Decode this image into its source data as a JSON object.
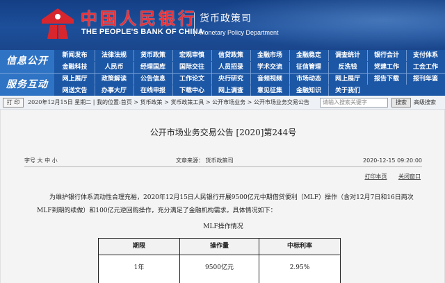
{
  "header": {
    "bank_name_cn": "中国人民银行",
    "bank_name_en": "THE PEOPLE'S BANK OF CHINA",
    "department_cn": "货币政策司",
    "department_en": "Monetary Policy Department",
    "logo_icon": "pboc-logo-icon",
    "brand_color": "#e8333a"
  },
  "nav": {
    "section1_title": "信息公开",
    "section1_items": [
      [
        "新闻发布",
        "法律法规",
        "货币政策",
        "宏观审慎",
        "信贷政策",
        "金融市场",
        "金融稳定",
        "调查统计",
        "银行会计",
        "支付体系"
      ],
      [
        "金融科技",
        "人民币",
        "经理国库",
        "国际交往",
        "人员招录",
        "学术交流",
        "征信管理",
        "反洗钱",
        "党建工作",
        "工会工作"
      ]
    ],
    "section2_title": "服务互动",
    "section2_items": [
      [
        "网上展厅",
        "政策解读",
        "公告信息",
        "工作论文",
        "央行研究",
        "音频视频",
        "市场动态",
        "网上展厅",
        "报告下载",
        "报刊年鉴"
      ],
      [
        "网送文告",
        "办事大厅",
        "在线申报",
        "下载中心",
        "网上调查",
        "意见征集",
        "金融知识",
        "关于我们",
        "",
        ""
      ]
    ]
  },
  "crumb": {
    "print_label": "打 印",
    "text": "2020年12月15日 星期二 | 我的位置:首页 > 货币政策 > 货币政策工具 > 公开市场业务 > 公开市场业务交易公告",
    "search_placeholder": "请输入搜索关键字",
    "search_button": "搜索",
    "advanced_search": "高级搜索"
  },
  "article": {
    "title": "公开市场业务交易公告 [2020]第244号",
    "font_size_label": "字号 大 中 小",
    "source": "文章来源：  货币政策司",
    "date": "2020-12-15 09:20:00",
    "print_label": "打印本页",
    "close_label": "关闭窗口",
    "paragraph": "为维护银行体系流动性合理充裕，2020年12月15日人民银行开展9500亿元中期借贷便利（MLF）操作（含对12月7日和16日两次MLF到期的续做）和100亿元逆回购操作，充分满足了金融机构需求。具体情况如下：",
    "table_title": "MLF操作情况",
    "table": {
      "headers": [
        "期限",
        "操作量",
        "中标利率"
      ],
      "rows": [
        [
          "1年",
          "9500亿元",
          "2.95%"
        ]
      ]
    }
  }
}
